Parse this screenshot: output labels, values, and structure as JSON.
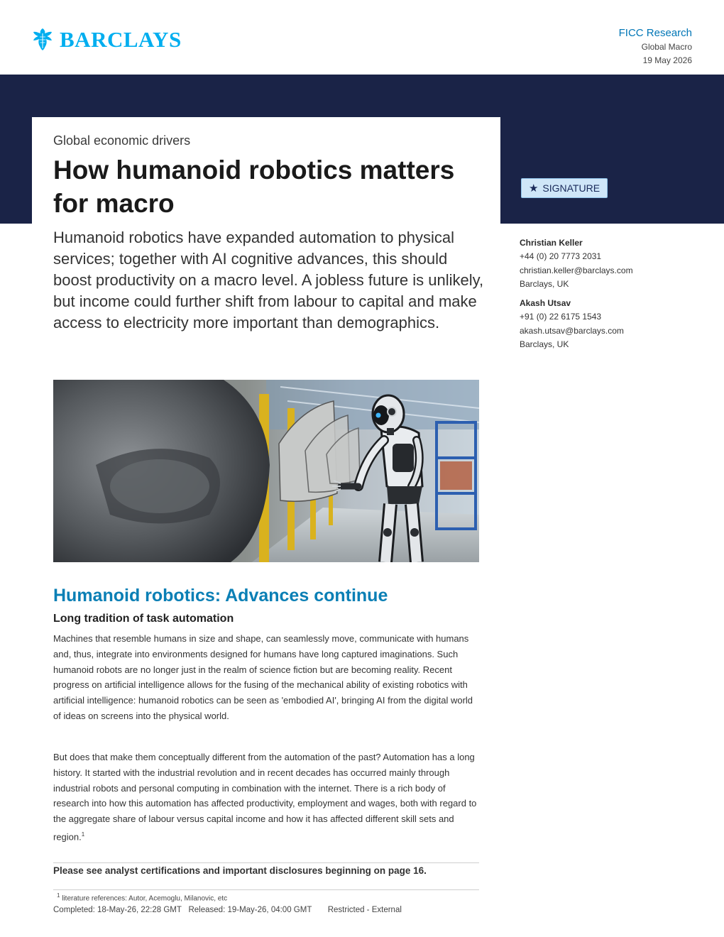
{
  "header": {
    "brand": "BARCLAYS",
    "department": "FICC Research",
    "section": "Global Macro",
    "date": "19 May 2026"
  },
  "title_block": {
    "kicker": "Global economic drivers",
    "title": "How humanoid robotics matters for macro",
    "lede": "Humanoid robotics have expanded automation to physical services; together with AI cognitive advances, this should boost productivity on a macro level. A jobless future is unlikely, but income could further shift from labour to capital and make access to electricity more important than demographics."
  },
  "badge": {
    "label": "SIGNATURE",
    "icon": "star-icon"
  },
  "authors": [
    {
      "name": "Christian Keller",
      "phone": "+44 (0) 20 7773 2031",
      "email": "christian.keller@barclays.com",
      "location": "Barclays, UK"
    },
    {
      "name": "Akash Utsav",
      "phone": "+91 (0) 22 6175 1543",
      "email": "akash.utsav@barclays.com",
      "location": "Barclays, UK"
    }
  ],
  "body": {
    "heading": "Humanoid robotics: Advances continue",
    "subheading": "Long tradition of task automation",
    "paragraph1": "Machines that resemble humans in size and shape, can seamlessly move, communicate with humans and, thus, integrate into environments designed for humans have long captured imaginations. Such humanoid robots are no longer just in the realm of science fiction but are becoming reality. Recent progress on artificial intelligence allows for the fusing of the mechanical ability of existing robotics with artificial intelligence: humanoid robotics can be seen as 'embodied AI', bringing AI from the digital world of ideas on screens into the physical world.",
    "paragraph2": "But does that make them conceptually different from the automation of the past? Automation has a long history. It started with the industrial revolution and in recent decades has occurred mainly through industrial robots and personal computing in combination with the internet. There is a rich body of research into how this automation has affected productivity, employment and wages, both with regard to the aggregate share of labour versus capital income and how it has affected different skill sets and region.",
    "footnote_ref": "1"
  },
  "footer": {
    "disclosure": "Please see analyst certifications and important disclosures beginning on page 16.",
    "footnote_num": "1",
    "footnote_text": "literature references: Autor, Acemoglu, Milanovic, etc",
    "completed": "Completed: 18-May-26, 22:28 GMT",
    "released": "Released: 19-May-26, 04:00 GMT",
    "classification": "Restricted - External"
  }
}
